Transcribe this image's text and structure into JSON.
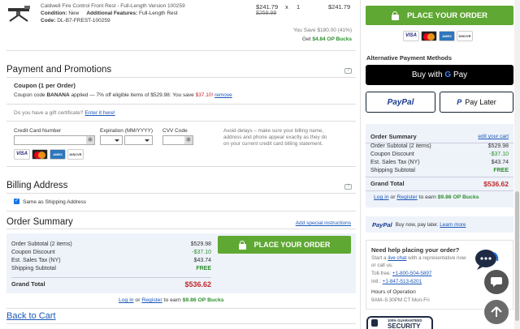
{
  "cart_item": {
    "name": "Caldwell Fire Control Front Rest - Full-Length Version 100259",
    "condition_label": "Condition:",
    "condition_value": "New",
    "features_label": "Additional Features:",
    "features_value": "Full-Length Rest",
    "code_label": "Code:",
    "code_value": "DL-B7-FREST-100259",
    "price": "$241.79",
    "old_price": "$259.99",
    "qty_sep": "x",
    "qty": "1",
    "line_total": "$241.79"
  },
  "savings": {
    "you_save": "You Save $180.00 (41%)",
    "get_prefix": "Get",
    "op_bucks": "$4.84 OP Bucks"
  },
  "payment": {
    "title": "Payment and Promotions",
    "coupon_title": "Coupon (1 per Order)",
    "coupon_prefix": "Coupon code",
    "coupon_code": "BANANA",
    "coupon_text": "applied — 7% off eligible items of $529.98: You save",
    "coupon_saved": "$37.10!",
    "coupon_remove": "remove",
    "gift_question": "Do you have a gift certificate?",
    "gift_link": "Enter it here!",
    "cc_label": "Credit Card Number",
    "exp_label": "Expiration (MM/YYYY)",
    "cvv_label": "CVV Code",
    "avoid_text": "Avoid delays – make sure your billing name, address and phone appear exactly as they do on your current credit card billing statement."
  },
  "billing": {
    "title": "Billing Address",
    "same_as_shipping": "Same as Shipping Address"
  },
  "order_summary": {
    "title": "Order Summary",
    "special_link": "Add special instructions",
    "rows": [
      {
        "label": "Order Subtotal (2 items)",
        "value": "$529.98"
      },
      {
        "label": "Coupon Discount",
        "value": "-$37.10"
      },
      {
        "label": "Est. Sales Tax (NY)",
        "value": "$43.74"
      },
      {
        "label": "Shipping Subtotal",
        "value": "FREE"
      }
    ],
    "grand_label": "Grand Total",
    "grand_value": "$536.62",
    "place_order": "PLACE YOUR ORDER",
    "login_link": "Log in",
    "or": "or",
    "register_link": "Register",
    "to_earn": "to earn",
    "earn_value": "$9.86 OP Bucks"
  },
  "back_to_cart": "Back to Cart",
  "sidebar": {
    "place_order": "PLACE YOUR ORDER",
    "alt_payment_title": "Alternative Payment Methods",
    "gpay_prefix": "Buy with",
    "gpay_g": "G",
    "gpay_pay": "Pay",
    "paypal": "PayPal",
    "paypal_later": "Pay Later",
    "summary_title": "Order Summary",
    "edit_cart": "edit your cart",
    "rows": [
      {
        "label": "Order Subtotal (2 items)",
        "value": "$529.98"
      },
      {
        "label": "Coupon Discount",
        "value": "-$37.10"
      },
      {
        "label": "Est. Sales Tax (NY)",
        "value": "$43.74"
      },
      {
        "label": "Shipping Subtotal",
        "value": "FREE"
      }
    ],
    "grand_label": "Grand Total",
    "grand_value": "$536.62",
    "login_link": "Log in",
    "or": "or",
    "register_link": "Register",
    "to_earn": "to earn",
    "earn_value": "$9.86 OP Bucks",
    "paypal_banner_logo": "PayPal",
    "paypal_banner_text": "Buy now, pay later.",
    "learn_more": "Learn more",
    "help_title": "Need help placing your order?",
    "help_start": "Start a",
    "live_chat": "live chat",
    "help_rest": "with a representative now or call us:",
    "tollfree_label": "Toll-free:",
    "tollfree": "+1-800-504-5897",
    "intl_label": "Intl.:",
    "intl": "+1-847-513-6201",
    "hours_title": "Hours of Operation",
    "hours": "9AM–5:30PM CT Mon-Fri",
    "security_top": "100% GUARANTEED",
    "security_main": "SECURITY"
  },
  "colors": {
    "green": "#5fa833",
    "red": "#c0282d",
    "link": "#1a56b8",
    "summary_bg": "#eef3fa"
  }
}
